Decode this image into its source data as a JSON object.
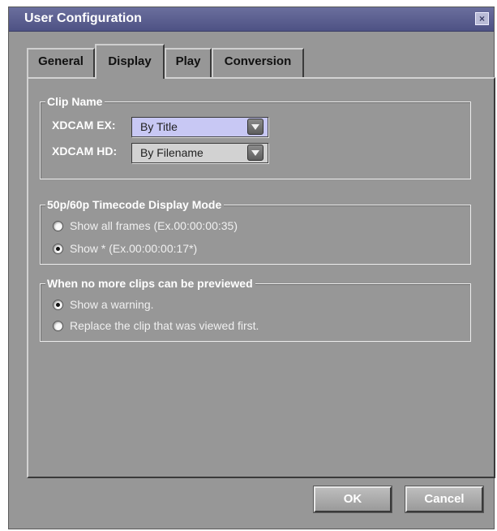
{
  "window": {
    "title": "User Configuration",
    "close_label": "×"
  },
  "tabs": [
    {
      "label": "General",
      "active": false
    },
    {
      "label": "Display",
      "active": true
    },
    {
      "label": "Play",
      "active": false
    },
    {
      "label": "Conversion",
      "active": false
    }
  ],
  "clip_name": {
    "legend": "Clip Name",
    "xdcam_ex": {
      "label": "XDCAM EX:",
      "value": "By Title",
      "highlighted": true
    },
    "xdcam_hd": {
      "label": "XDCAM HD:",
      "value": "By Filename",
      "highlighted": false
    }
  },
  "timecode": {
    "legend": "50p/60p Timecode Display Mode",
    "options": [
      {
        "label": "Show all frames (Ex.00:00:00:35)",
        "selected": false
      },
      {
        "label": "Show * (Ex.00:00:00:17*)",
        "selected": true
      }
    ]
  },
  "preview_limit": {
    "legend": "When no more clips can be previewed",
    "options": [
      {
        "label": "Show a warning.",
        "selected": true
      },
      {
        "label": "Replace the clip that was viewed first.",
        "selected": false
      }
    ]
  },
  "buttons": {
    "ok": "OK",
    "cancel": "Cancel"
  },
  "colors": {
    "titlebar": "#4e5284",
    "dialog_bg": "#979797",
    "combo_highlight": "#c8c8f4",
    "combo_normal": "#d2d2d2"
  }
}
